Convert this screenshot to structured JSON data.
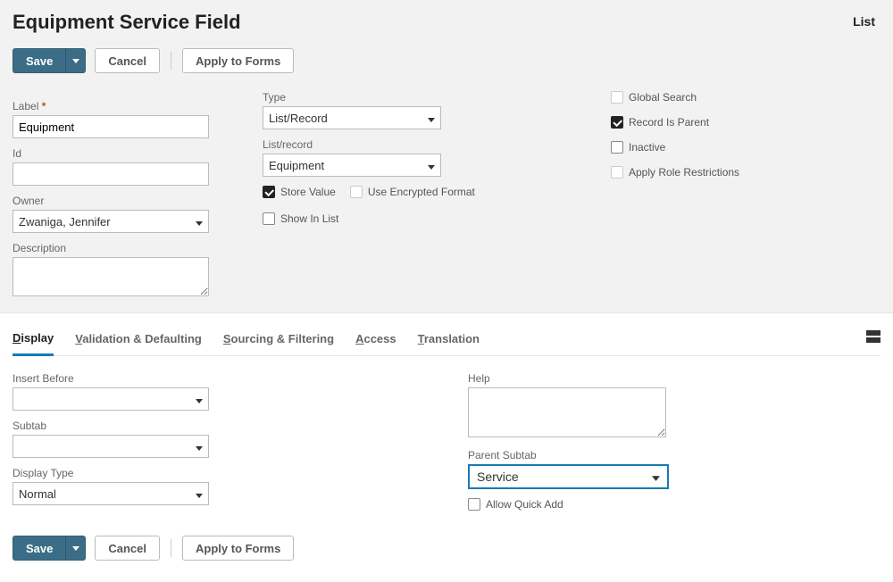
{
  "header": {
    "title": "Equipment Service Field",
    "list_link": "List"
  },
  "actions": {
    "save": "Save",
    "cancel": "Cancel",
    "apply_to_forms": "Apply to Forms"
  },
  "fields": {
    "label": {
      "label": "Label",
      "value": "Equipment"
    },
    "id": {
      "label": "Id",
      "value": ""
    },
    "owner": {
      "label": "Owner",
      "value": "Zwaniga, Jennifer"
    },
    "description": {
      "label": "Description",
      "value": ""
    },
    "type": {
      "label": "Type",
      "value": "List/Record"
    },
    "list_record": {
      "label": "List/record",
      "value": "Equipment"
    },
    "store_value": {
      "label": "Store Value",
      "checked": true
    },
    "use_encrypted_format": {
      "label": "Use Encrypted Format",
      "checked": false
    },
    "show_in_list": {
      "label": "Show In List",
      "checked": false
    },
    "global_search": {
      "label": "Global Search",
      "checked": false
    },
    "record_is_parent": {
      "label": "Record Is Parent",
      "checked": true
    },
    "inactive": {
      "label": "Inactive",
      "checked": false
    },
    "apply_role_restrictions": {
      "label": "Apply Role Restrictions",
      "checked": false
    }
  },
  "tabs": [
    {
      "id": "display",
      "label": "Display",
      "ul": "D",
      "rest": "isplay",
      "active": true
    },
    {
      "id": "validation",
      "label": "Validation & Defaulting",
      "ul": "V",
      "rest": "alidation & Defaulting",
      "active": false
    },
    {
      "id": "sourcing",
      "label": "Sourcing & Filtering",
      "ul": "S",
      "rest": "ourcing & Filtering",
      "active": false
    },
    {
      "id": "access",
      "label": "Access",
      "ul": "A",
      "rest": "ccess",
      "active": false
    },
    {
      "id": "translation",
      "label": "Translation",
      "ul": "T",
      "rest": "ranslation",
      "active": false
    }
  ],
  "display_tab": {
    "insert_before": {
      "label": "Insert Before",
      "value": ""
    },
    "subtab": {
      "label": "Subtab",
      "value": ""
    },
    "display_type": {
      "label": "Display Type",
      "value": "Normal"
    },
    "help": {
      "label": "Help",
      "value": ""
    },
    "parent_subtab": {
      "label": "Parent Subtab",
      "value": "Service"
    },
    "allow_quick_add": {
      "label": "Allow Quick Add",
      "checked": false
    }
  }
}
